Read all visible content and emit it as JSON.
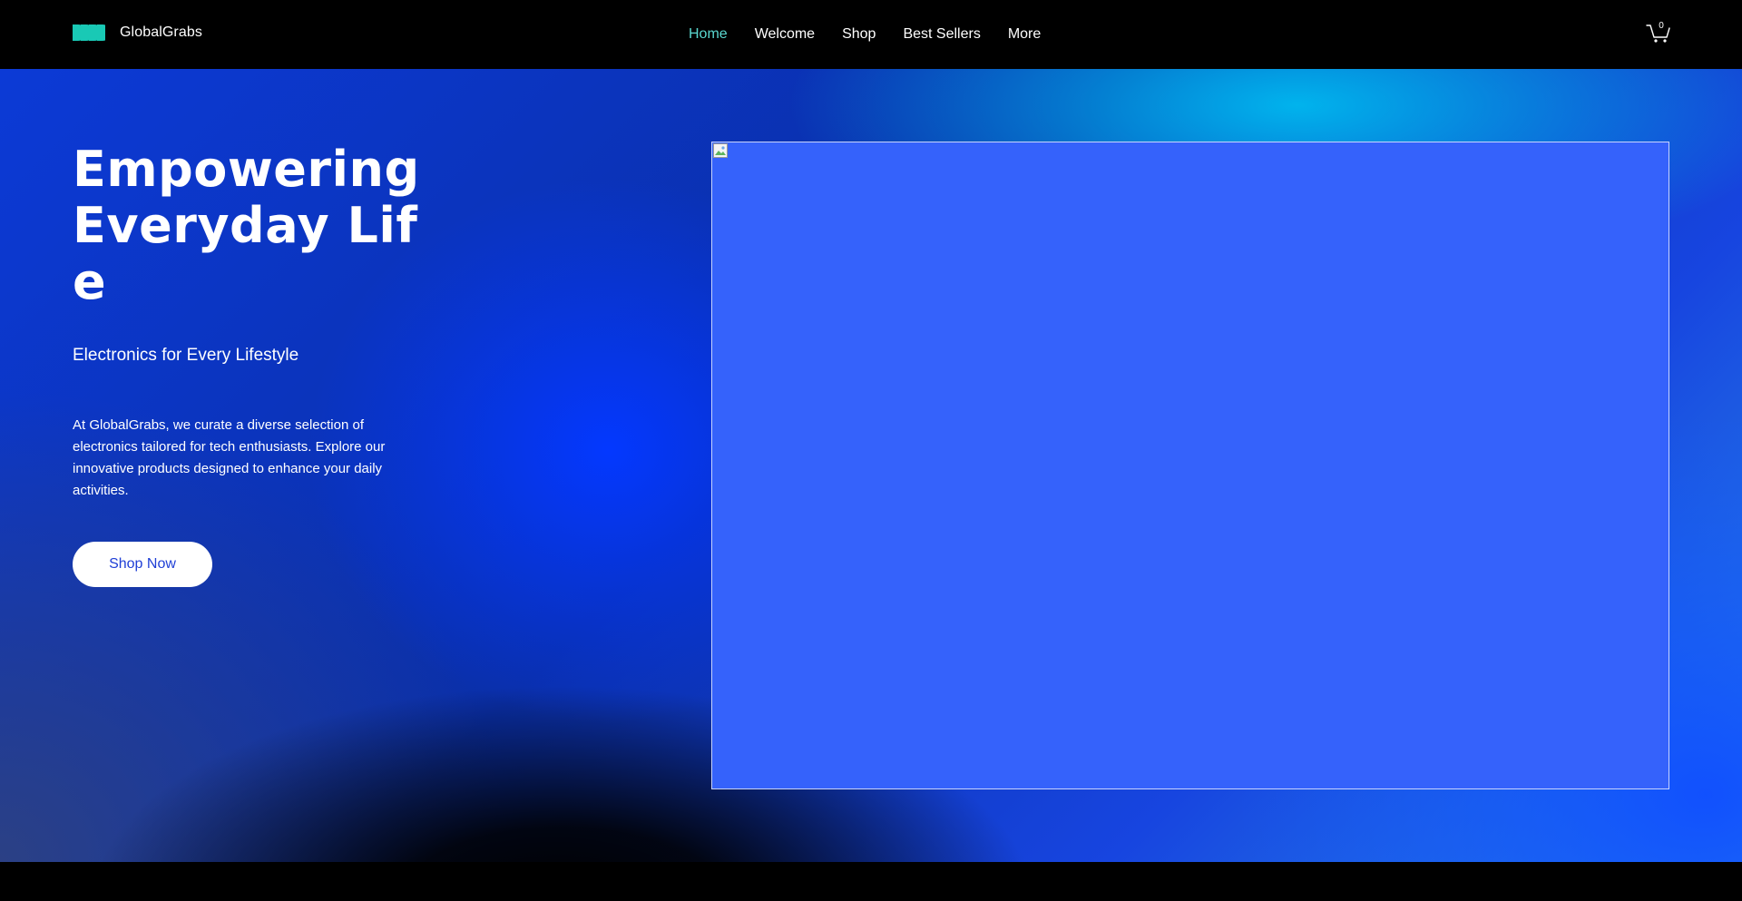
{
  "header": {
    "brand_name": "GlobalGrabs",
    "logo_icon": "four-teal-arrows-logo-icon",
    "nav": [
      {
        "label": "Home",
        "active": true
      },
      {
        "label": "Welcome",
        "active": false
      },
      {
        "label": "Shop",
        "active": false
      },
      {
        "label": "Best Sellers",
        "active": false
      },
      {
        "label": "More",
        "active": false
      }
    ],
    "cart": {
      "icon": "cart-icon",
      "count": "0"
    }
  },
  "hero": {
    "title": "Empowering Everyday Life",
    "subtitle": "Electronics for Every Lifestyle",
    "description": "At GlobalGrabs, we curate a diverse selection of electronics tailored for tech enthusiasts. Explore our innovative products designed to enhance your daily activities.",
    "cta_label": "Shop Now",
    "image_icon": "broken-image-icon"
  },
  "colors": {
    "accent": "#5ad8d0",
    "logo": "#19c9b5",
    "image_placeholder": "#3562fb",
    "cta_text": "#1f3fd6",
    "header_bg": "#000000"
  }
}
